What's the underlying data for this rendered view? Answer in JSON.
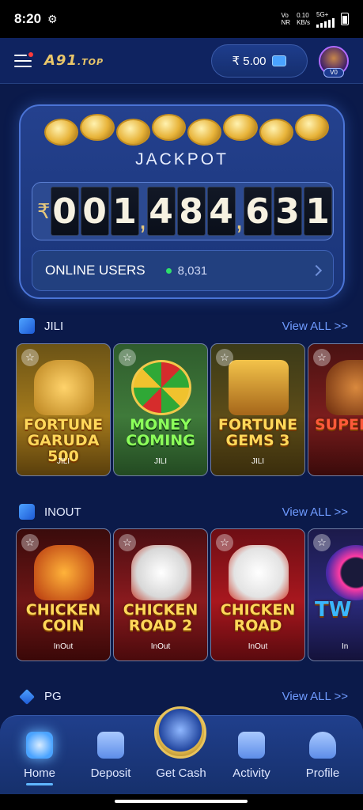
{
  "status_bar": {
    "time": "8:20",
    "net1": "Vo",
    "net2": "NR",
    "speed": "0.10",
    "speed_unit": "KB/s",
    "network": "5G+"
  },
  "app_bar": {
    "logo_main": "A91",
    "logo_suffix": ".TOP",
    "balance": "₹ 5.00",
    "avatar_badge": "V0"
  },
  "jackpot": {
    "title": "JACKPOT",
    "currency": "₹",
    "groups": [
      [
        "0",
        "0",
        "1"
      ],
      [
        "4",
        "8",
        "4"
      ],
      [
        "6",
        "3",
        "1"
      ]
    ],
    "online_label": "ONLINE USERS",
    "online_count": "8,031"
  },
  "sections": [
    {
      "title": "JILI",
      "view_all": "View ALL >>",
      "games": [
        {
          "title": "FORTUNE GARUDA 500",
          "provider": "JILI"
        },
        {
          "title": "MONEY COMING",
          "provider": "JILI"
        },
        {
          "title": "FORTUNE GEMS 3",
          "provider": "JILI"
        },
        {
          "title": "SUPER DE",
          "provider": ""
        }
      ]
    },
    {
      "title": "INOUT",
      "view_all": "View ALL >>",
      "games": [
        {
          "title": "CHICKEN COIN",
          "provider": "InOut"
        },
        {
          "title": "CHICKEN ROAD 2",
          "provider": "InOut"
        },
        {
          "title": "CHICKEN ROAD",
          "provider": "InOut"
        },
        {
          "title": "TW",
          "provider": "In"
        }
      ]
    },
    {
      "title": "PG",
      "view_all": "View ALL >>"
    }
  ],
  "bottom_nav": [
    {
      "label": "Home",
      "icon": "home-icon"
    },
    {
      "label": "Deposit",
      "icon": "wallet-icon"
    },
    {
      "label": "Get Cash",
      "icon": "get-cash-icon"
    },
    {
      "label": "Activity",
      "icon": "gift-icon"
    },
    {
      "label": "Profile",
      "icon": "profile-icon"
    }
  ]
}
